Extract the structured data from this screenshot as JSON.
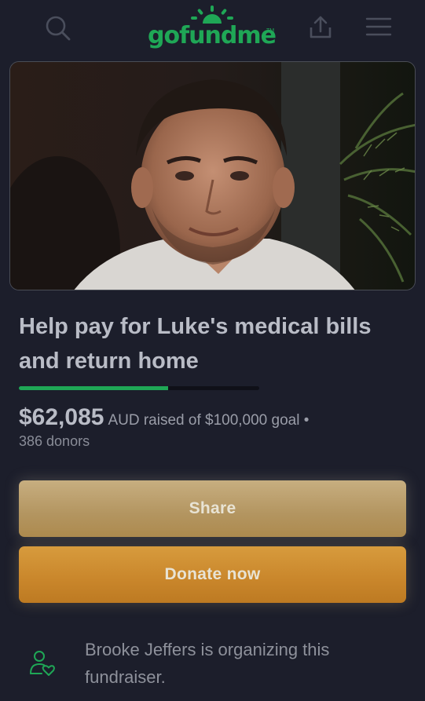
{
  "header": {
    "logo_text": "gofundme",
    "logo_tm": "TM",
    "brand_color": "#1fa756",
    "icons": [
      "search-icon",
      "upload-icon",
      "hamburger-menu-icon"
    ]
  },
  "campaign": {
    "title": "Help pay for Luke's medical bills and return home",
    "amount_raised": "$62,085",
    "raised_suffix": "AUD raised of $100,000 goal •",
    "donors": "386 donors",
    "progress_fraction": 0.62
  },
  "buttons": {
    "share_label": "Share",
    "donate_label": "Donate now"
  },
  "organizer": {
    "text": "Brooke Jeffers is organizing this fundraiser.",
    "icon": "person-heart-icon"
  },
  "colors": {
    "background": "#1c1e2b",
    "share_button": "#b89a66",
    "donate_button": "#cc892c"
  }
}
